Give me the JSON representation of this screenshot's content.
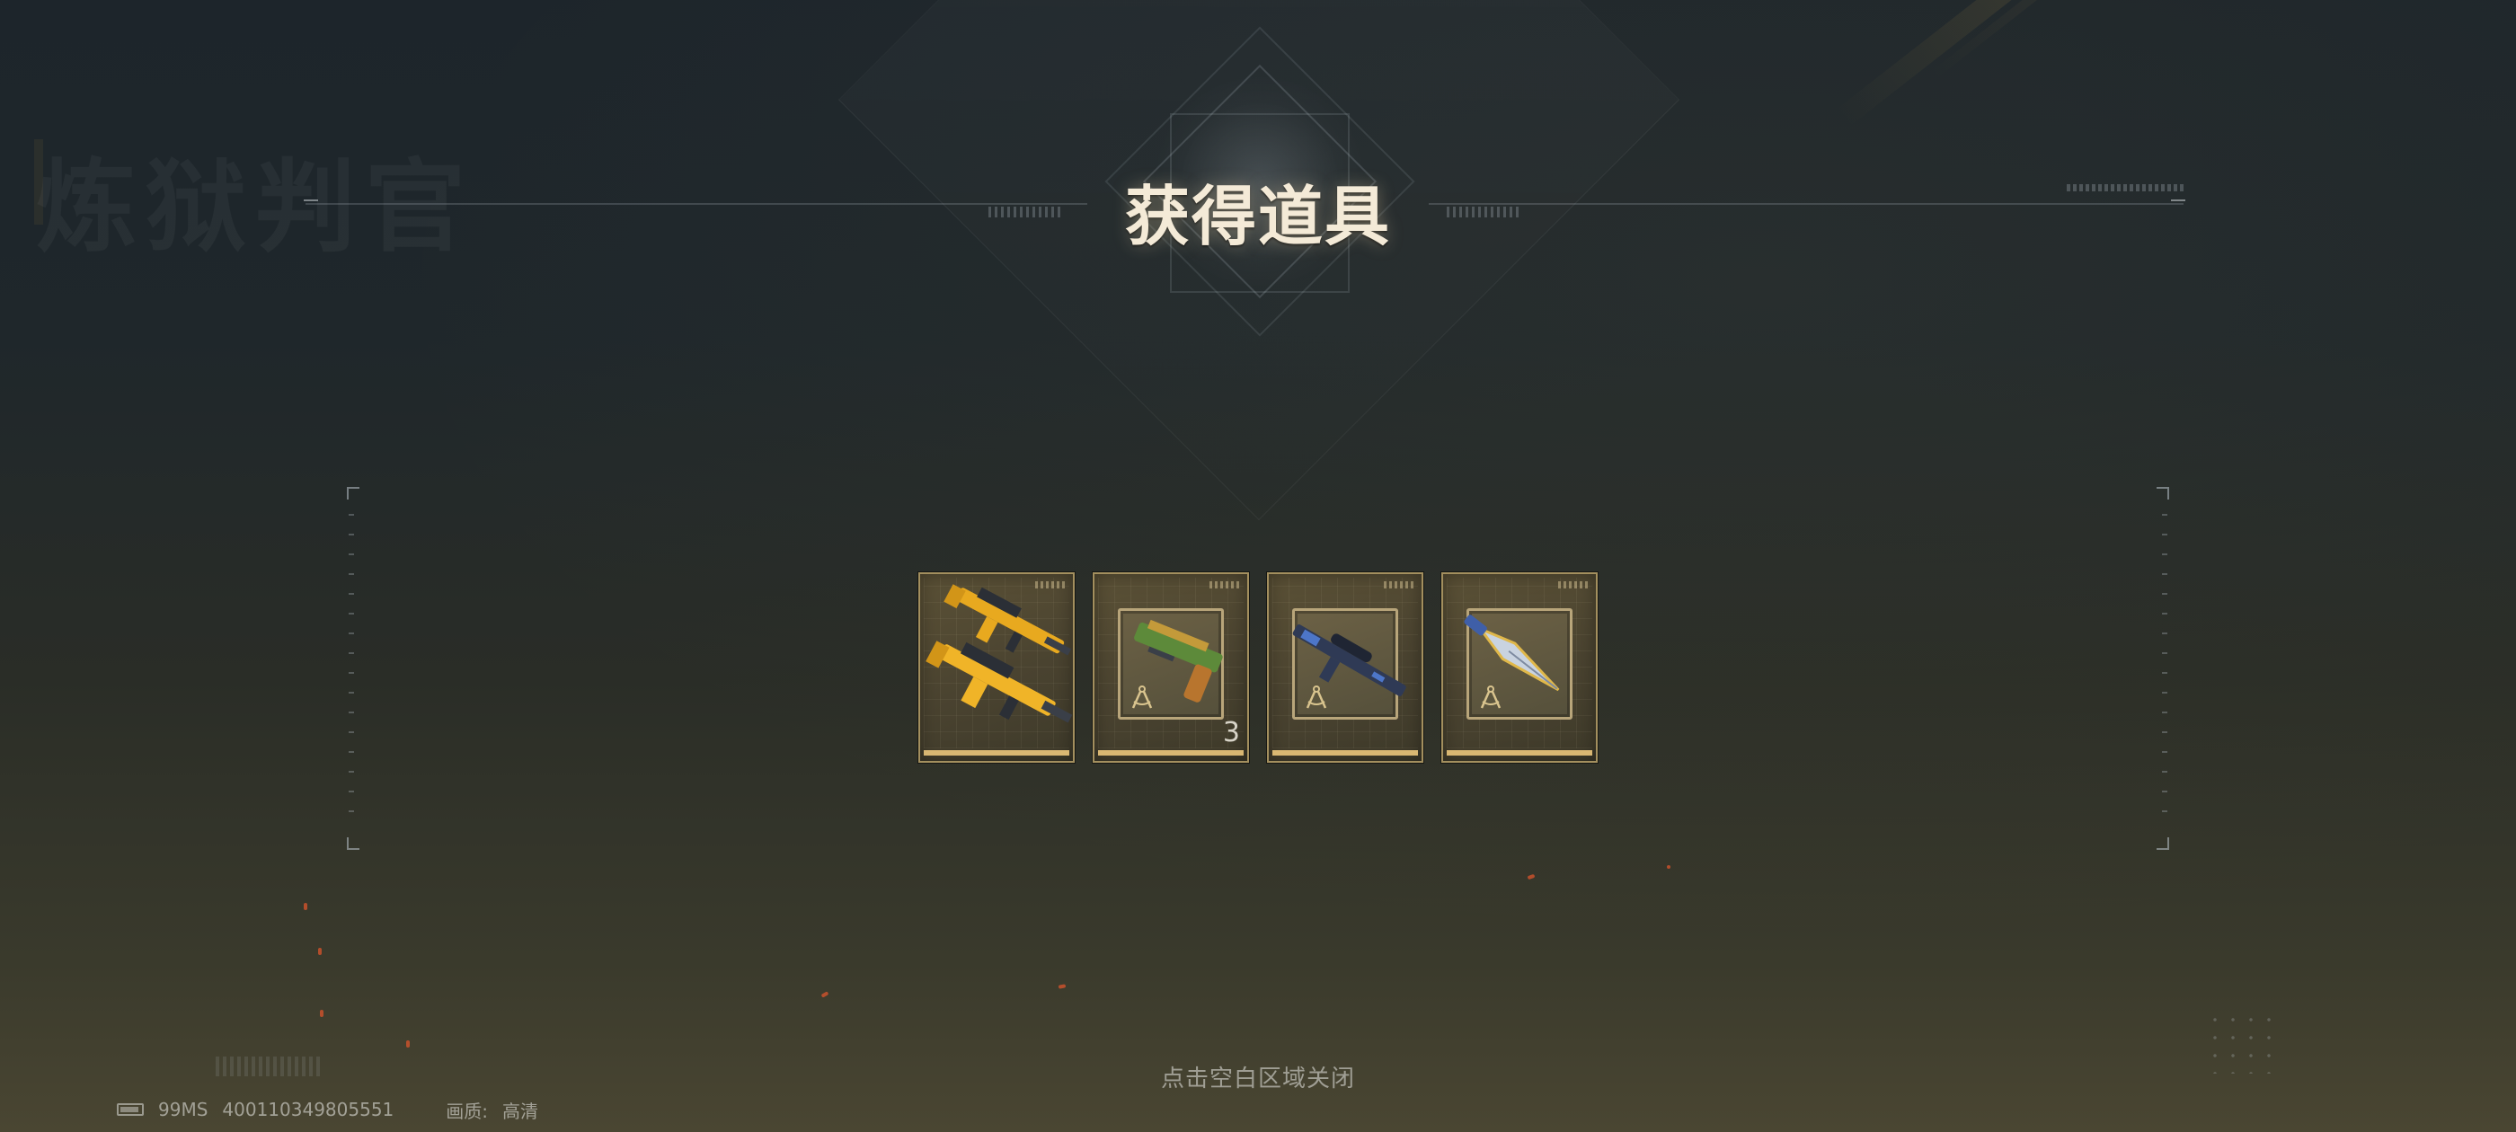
{
  "title": "获得道具",
  "background_ghost_title": "炼狱判官",
  "items": [
    {
      "name": "yellow-rifle-skin",
      "count": null,
      "type": "skin"
    },
    {
      "name": "pistol-blueprint",
      "count": "3",
      "type": "blueprint"
    },
    {
      "name": "sniper-rifle-blueprint",
      "count": null,
      "type": "blueprint"
    },
    {
      "name": "knife-blueprint",
      "count": null,
      "type": "blueprint"
    }
  ],
  "footer": {
    "close_hint": "点击空白区域关闭"
  },
  "status": {
    "ping": "99MS",
    "player_id": "400110349805551",
    "quality_label": "画质:",
    "quality_value": "高清"
  },
  "colors": {
    "title": "#f4ead7",
    "item_border": "#a38f5e",
    "item_bar": "#d9b772",
    "ember": "#d1532c"
  },
  "icons": [
    "battery-icon",
    "compass-icon"
  ]
}
